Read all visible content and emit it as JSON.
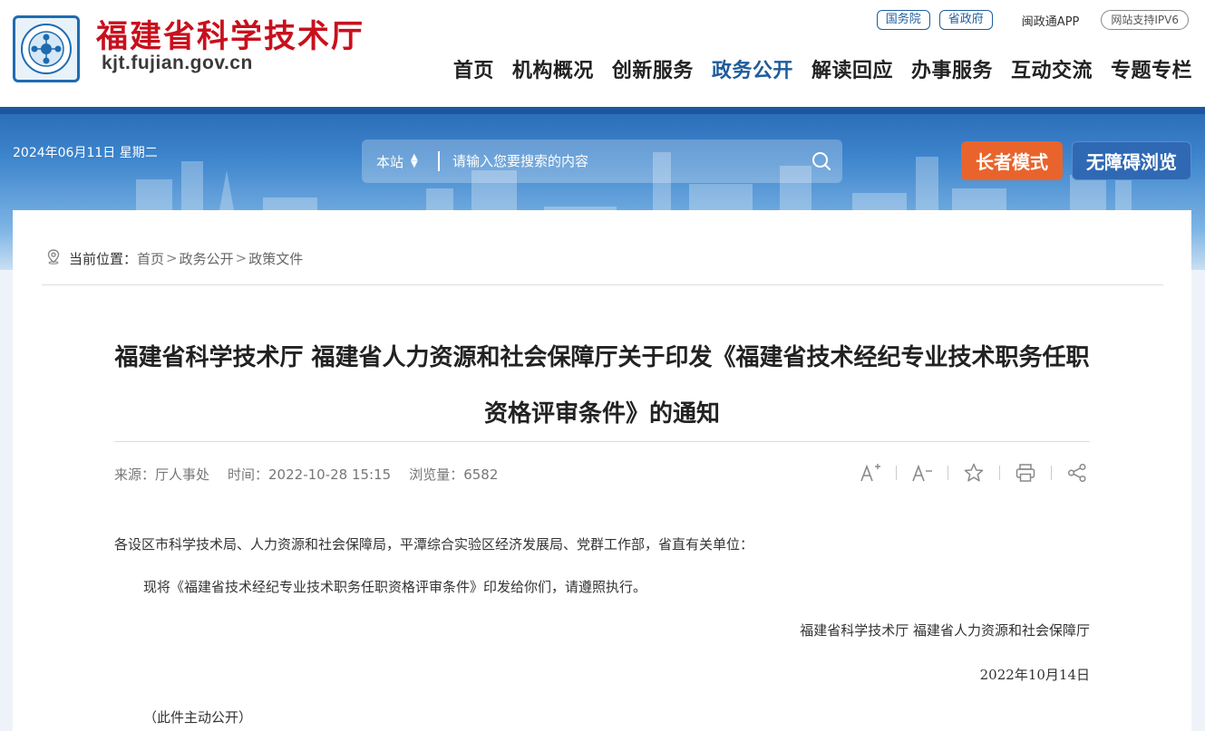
{
  "header": {
    "site_name": "福建省科学技术厅",
    "domain": "kjt.fujian.gov.cn",
    "top_links": {
      "state_council": "国务院",
      "provincial_gov": "省政府",
      "app": "闽政通APP",
      "ipv6": "网站支持IPV6"
    },
    "nav": [
      {
        "label": "首页"
      },
      {
        "label": "机构概况"
      },
      {
        "label": "创新服务"
      },
      {
        "label": "政务公开"
      },
      {
        "label": "解读回应"
      },
      {
        "label": "办事服务"
      },
      {
        "label": "互动交流"
      },
      {
        "label": "专题专栏"
      }
    ],
    "active_nav": "政务公开",
    "colors": {
      "brand_red": "#c8101d",
      "nav_active": "#1e5c9c"
    }
  },
  "banner": {
    "date": "2024年06月11日 星期二",
    "search": {
      "scope": "本站",
      "placeholder": "请输入您要搜索的内容",
      "button_icon": "search-icon"
    },
    "elder_mode": "长者模式",
    "accessible_mode": "无障碍浏览",
    "colors": {
      "elder": "#e8642c",
      "accessible": "#2f69b3"
    }
  },
  "breadcrumb": {
    "icon": "location-icon",
    "prefix": "当前位置：",
    "items": [
      "首页",
      "政务公开",
      "政策文件"
    ],
    "separator": ">"
  },
  "article": {
    "title": "福建省科学技术厅 福建省人力资源和社会保障厅关于印发《福建省技术经纪专业技术职务任职资格评审条件》的通知",
    "meta": {
      "source": "来源：厅人事处",
      "time": "时间：2022-10-28 15:15",
      "views": "浏览量：6582"
    },
    "tools": [
      "font-increase-icon",
      "font-decrease-icon",
      "star-icon",
      "print-icon",
      "share-icon"
    ],
    "paragraphs": {
      "salutation": "各设区市科学技术局、人力资源和社会保障局，平潭综合实验区经济发展局、党群工作部，省直有关单位：",
      "body": "现将《福建省技术经纪专业技术职务任职资格评审条件》印发给你们，请遵照执行。",
      "signature": "福建省科学技术厅 福建省人力资源和社会保障厅",
      "date": "2022年10月14日",
      "note": "（此件主动公开）"
    }
  }
}
